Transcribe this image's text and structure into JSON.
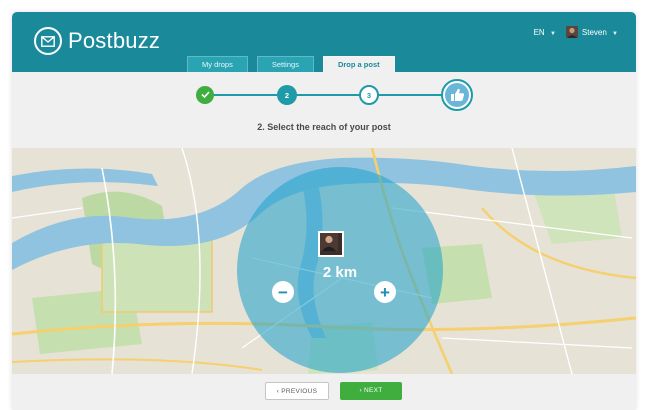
{
  "app": {
    "name": "Postbuzz"
  },
  "header": {
    "language": "EN",
    "user_name": "Steven"
  },
  "tabs": [
    {
      "label": "My drops",
      "active": false
    },
    {
      "label": "Settings",
      "active": false
    },
    {
      "label": "Drop a post",
      "active": true
    }
  ],
  "steps": [
    {
      "label": "",
      "state": "done"
    },
    {
      "label": "2",
      "state": "current"
    },
    {
      "label": "3",
      "state": "upcoming"
    },
    {
      "label": "",
      "state": "final",
      "icon": "thumbs-up-icon"
    }
  ],
  "step_title": "2. Select the reach of your post",
  "map": {
    "radius_label": "2 km",
    "minus_label": "−",
    "plus_label": "+"
  },
  "footer": {
    "previous_label": "‹ PREVIOUS",
    "next_label": "› NEXT"
  },
  "colors": {
    "brand": "#1a8a9a",
    "step_accent": "#1e9aa8",
    "done": "#3fae3f",
    "radius_overlay": "#24a3cc",
    "next_button": "#3fae3f"
  }
}
